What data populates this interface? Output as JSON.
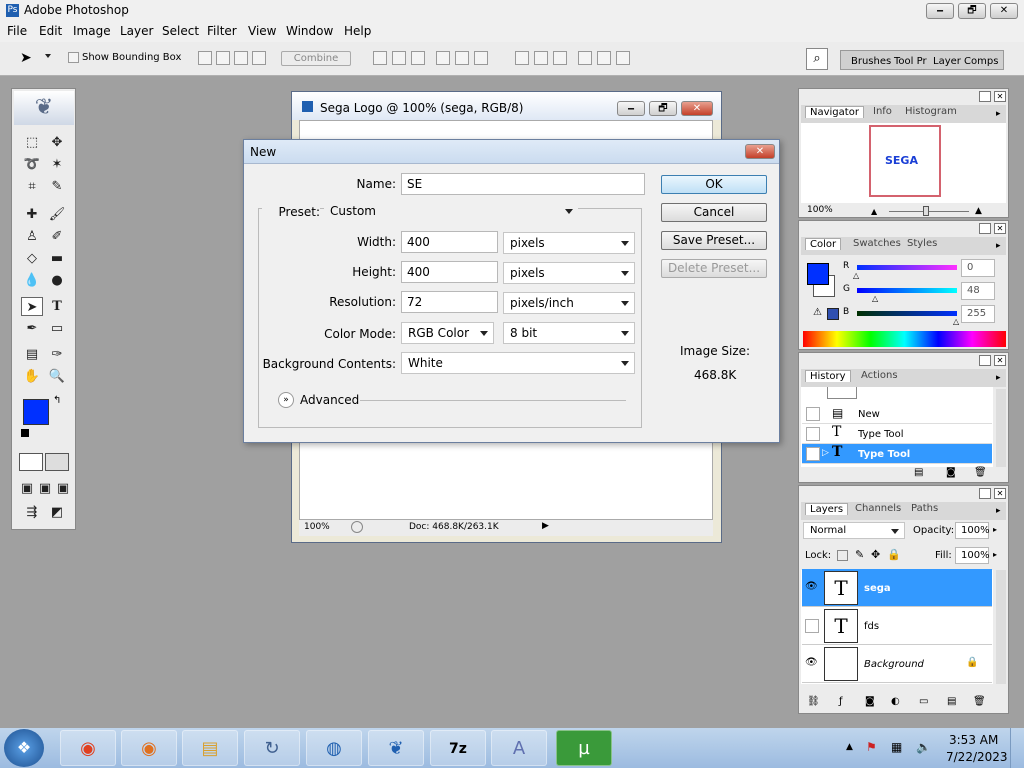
{
  "app": {
    "title": "Adobe Photoshop",
    "minimize": "🗕",
    "restore": "🗗",
    "close": "✕"
  },
  "menu": [
    "File",
    "Edit",
    "Image",
    "Layer",
    "Select",
    "Filter",
    "View",
    "Window",
    "Help"
  ],
  "options": {
    "show_bounding_box": "Show Bounding Box",
    "combine": "Combine",
    "tabs": [
      "Brushes",
      "Tool Pr",
      "Layer Comps"
    ]
  },
  "document": {
    "title": "Sega Logo @ 100% (sega, RGB/8)",
    "zoom": "100%",
    "doc_info": "Doc: 468.8K/263.1K"
  },
  "dialog": {
    "title": "New",
    "name_label": "Name:",
    "name_value": "SE",
    "preset_label": "Preset:",
    "preset_value": "Custom",
    "width_label": "Width:",
    "width_value": "400",
    "width_unit": "pixels",
    "height_label": "Height:",
    "height_value": "400",
    "height_unit": "pixels",
    "resolution_label": "Resolution:",
    "resolution_value": "72",
    "resolution_unit": "pixels/inch",
    "color_mode_label": "Color Mode:",
    "color_mode_value": "RGB Color",
    "bit_depth": "8 bit",
    "bg_label": "Background Contents:",
    "bg_value": "White",
    "advanced": "Advanced",
    "ok": "OK",
    "cancel": "Cancel",
    "save_preset": "Save Preset...",
    "delete_preset": "Delete Preset...",
    "image_size_label": "Image Size:",
    "image_size_value": "468.8K"
  },
  "navigator": {
    "tabs": [
      "Navigator",
      "Info",
      "Histogram"
    ],
    "zoom": "100%",
    "preview_text": "SEGA"
  },
  "color": {
    "tabs": [
      "Color",
      "Swatches",
      "Styles"
    ],
    "r_label": "R",
    "g_label": "G",
    "b_label": "B",
    "r": "0",
    "g": "48",
    "b": "255",
    "fg": "#0030ff"
  },
  "history": {
    "tabs": [
      "History",
      "Actions"
    ],
    "items": [
      "New",
      "Type Tool",
      "Type Tool"
    ]
  },
  "layers": {
    "tabs": [
      "Layers",
      "Channels",
      "Paths"
    ],
    "blend": "Normal",
    "opacity_label": "Opacity:",
    "opacity": "100%",
    "lock_label": "Lock:",
    "fill_label": "Fill:",
    "fill": "100%",
    "items": [
      {
        "name": "sega",
        "thumb": "T"
      },
      {
        "name": "fds",
        "thumb": "T"
      },
      {
        "name": "Background",
        "thumb": ""
      }
    ]
  },
  "taskbar": {
    "time": "3:53 AM",
    "date": "7/22/2023"
  }
}
